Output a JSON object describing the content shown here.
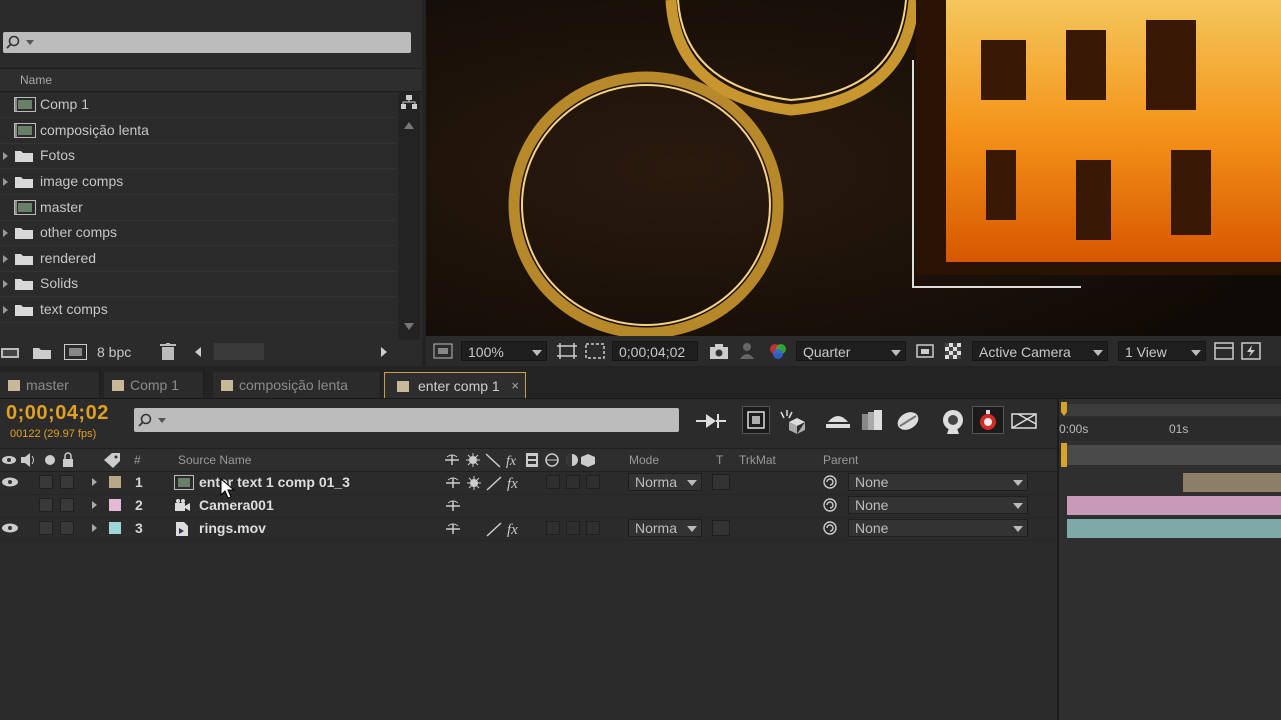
{
  "project": {
    "column_name": "Name",
    "items": [
      {
        "label": "Comp 1",
        "type": "comp",
        "expandable": false
      },
      {
        "label": "composição lenta",
        "type": "comp",
        "expandable": false
      },
      {
        "label": "Fotos",
        "type": "folder",
        "expandable": true
      },
      {
        "label": "image comps",
        "type": "folder",
        "expandable": true
      },
      {
        "label": "master",
        "type": "comp",
        "expandable": false
      },
      {
        "label": "other comps",
        "type": "folder",
        "expandable": true
      },
      {
        "label": "rendered",
        "type": "folder",
        "expandable": true
      },
      {
        "label": "Solids",
        "type": "folder",
        "expandable": true
      },
      {
        "label": "text comps",
        "type": "folder",
        "expandable": true
      }
    ],
    "bit_depth": "8 bpc"
  },
  "viewer": {
    "zoom": "100%",
    "timecode": "0;00;04;02",
    "resolution": "Quarter",
    "camera": "Active Camera",
    "views": "1 View"
  },
  "tabs": [
    {
      "label": "master",
      "active": false
    },
    {
      "label": "Comp 1",
      "active": false
    },
    {
      "label": "composição lenta",
      "active": false
    },
    {
      "label": "enter comp 1",
      "active": true,
      "close": "×"
    }
  ],
  "timeline": {
    "timecode": "0;00;04;02",
    "frames": "00122 (29.97 fps)",
    "columns": {
      "number": "#",
      "source_name": "Source Name",
      "mode": "Mode",
      "t": "T",
      "trkmat": "TrkMat",
      "parent": "Parent"
    },
    "ruler": {
      "start": "0:00s",
      "mark": "01s"
    },
    "layers": [
      {
        "num": "1",
        "name": "enter text 1 comp 01_3",
        "label_color": "#b8a888",
        "mode": "Norma",
        "parent": "None",
        "bar_color": "#8c7f68"
      },
      {
        "num": "2",
        "name": "Camera001",
        "label_color": "#e6b8d8",
        "mode": "",
        "parent": "None",
        "bar_color": "#c99ab7"
      },
      {
        "num": "3",
        "name": "rings.mov",
        "label_color": "#9fd7d6",
        "mode": "Norma",
        "parent": "None",
        "bar_color": "#7fa9a7"
      }
    ]
  },
  "colors": {
    "accent": "#e0a020",
    "panel": "#2b2b2b"
  }
}
